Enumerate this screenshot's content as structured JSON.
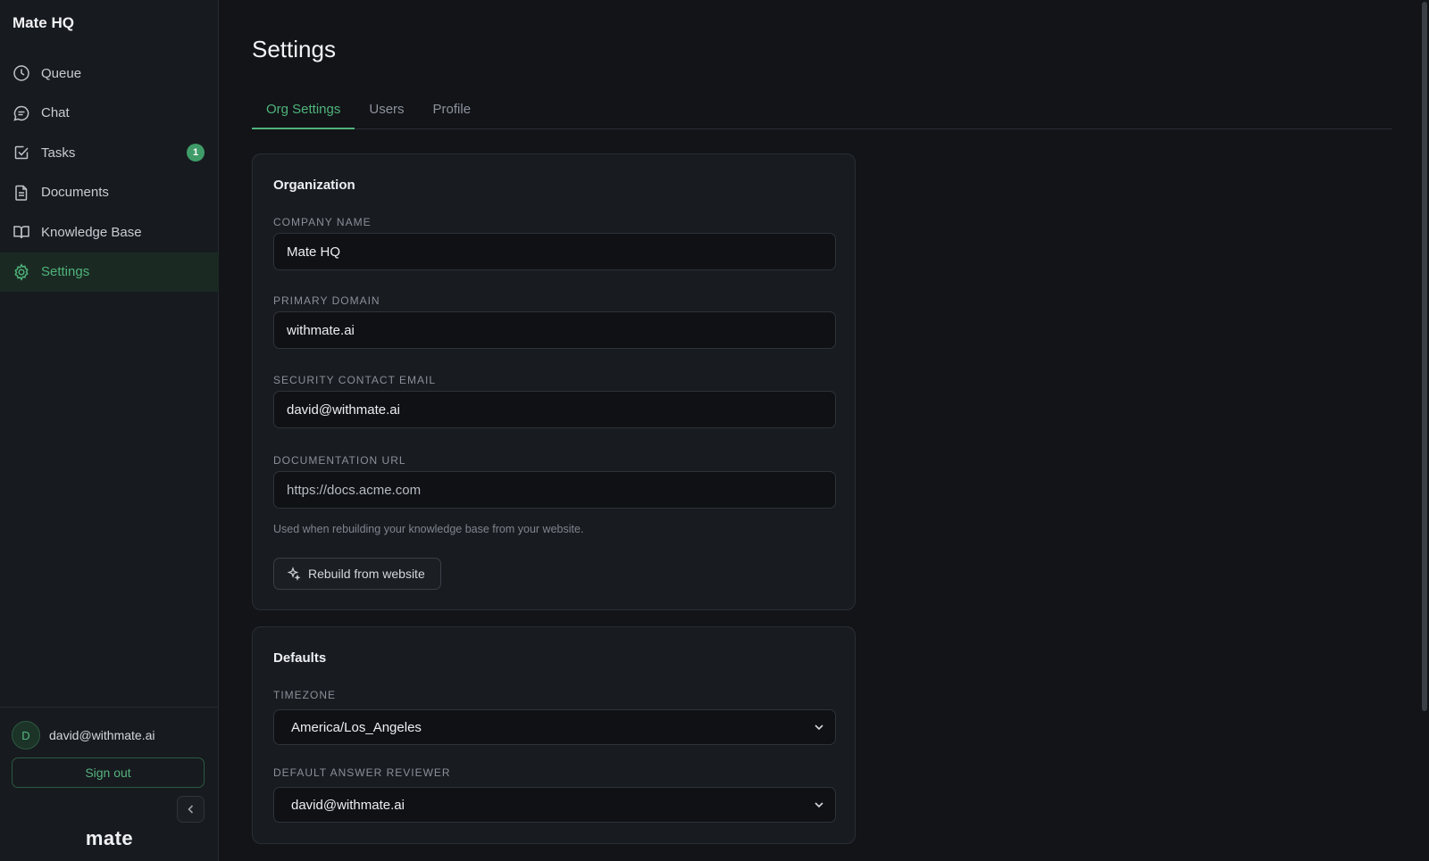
{
  "app": {
    "title": "Mate HQ",
    "brand": "mate"
  },
  "sidebar": {
    "items": [
      {
        "label": "Queue",
        "icon": "clock-icon"
      },
      {
        "label": "Chat",
        "icon": "chat-bubble-icon"
      },
      {
        "label": "Tasks",
        "icon": "checkbox-icon",
        "badge": "1"
      },
      {
        "label": "Documents",
        "icon": "document-icon"
      },
      {
        "label": "Knowledge Base",
        "icon": "book-icon"
      },
      {
        "label": "Settings",
        "icon": "gear-icon",
        "active": true
      }
    ],
    "user": {
      "initial": "D",
      "email": "david@withmate.ai"
    },
    "sign_out_label": "Sign out"
  },
  "page": {
    "title": "Settings",
    "tabs": [
      {
        "label": "Org Settings",
        "active": true
      },
      {
        "label": "Users"
      },
      {
        "label": "Profile"
      }
    ]
  },
  "organization": {
    "title": "Organization",
    "company_name_label": "COMPANY NAME",
    "company_name": "Mate HQ",
    "primary_domain_label": "PRIMARY DOMAIN",
    "primary_domain": "withmate.ai",
    "security_email_label": "SECURITY CONTACT EMAIL",
    "security_email": "david@withmate.ai",
    "documentation_url_label": "DOCUMENTATION URL",
    "documentation_url_placeholder": "https://docs.acme.com",
    "documentation_help": "Used when rebuilding your knowledge base from your website.",
    "rebuild_label": "Rebuild from website"
  },
  "defaults": {
    "title": "Defaults",
    "timezone_label": "TIMEZONE",
    "timezone": "America/Los_Angeles",
    "reviewer_label": "DEFAULT ANSWER REVIEWER",
    "reviewer": "david@withmate.ai"
  },
  "colors": {
    "accent": "#4fb37a",
    "background": "#121418",
    "sidebar": "#171a1f"
  }
}
